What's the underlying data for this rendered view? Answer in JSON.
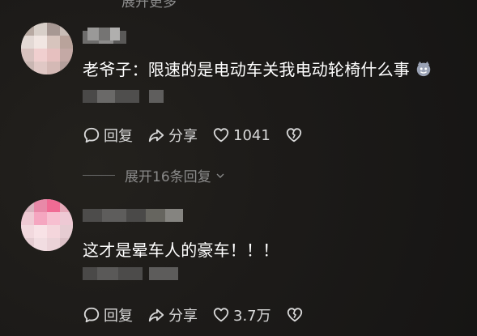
{
  "top_expand": {
    "label": "展开更多"
  },
  "comments": [
    {
      "text": "老爷子：限速的是电动车关我电动轮椅什么事",
      "emoji": "cat-face-icon",
      "reply_label": "回复",
      "share_label": "分享",
      "like_count": "1041"
    },
    {
      "text": "这才是晕车人的豪车！！！",
      "reply_label": "回复",
      "share_label": "分享",
      "like_count": "3.7万"
    }
  ],
  "expand_replies": {
    "label": "展开16条回复"
  }
}
